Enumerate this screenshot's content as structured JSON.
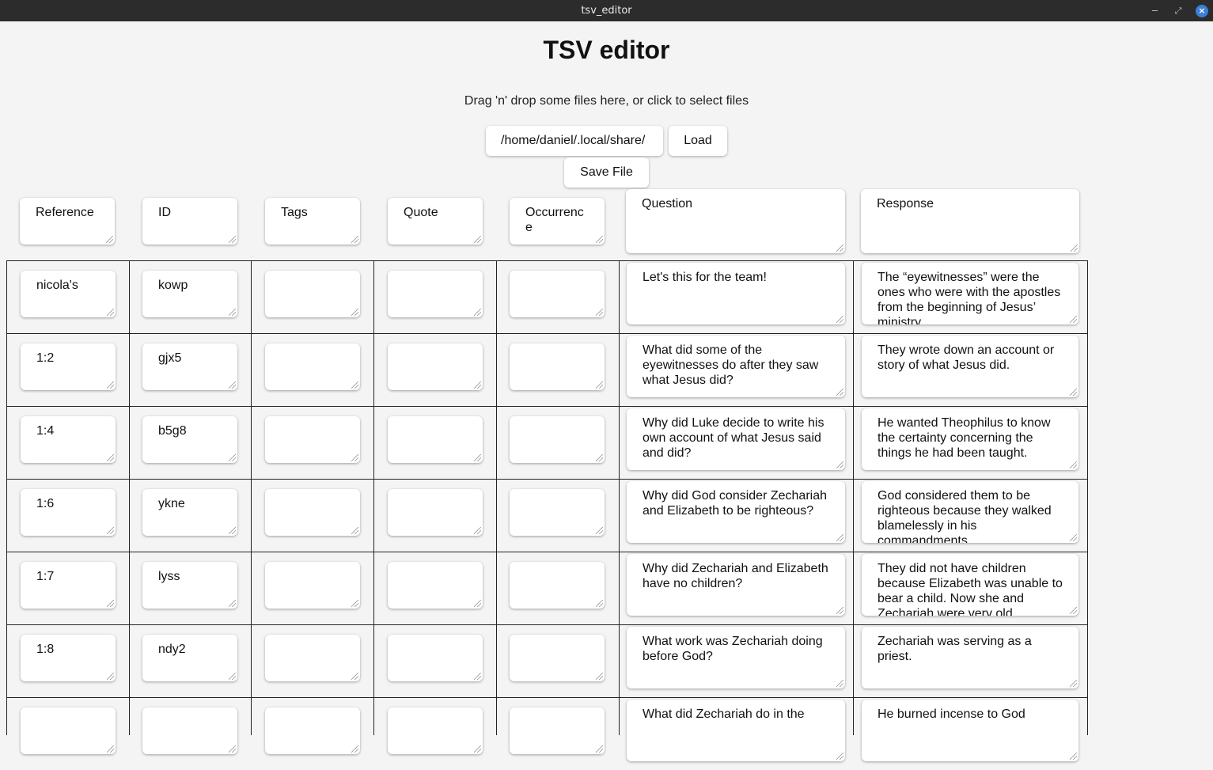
{
  "window": {
    "title": "tsv_editor"
  },
  "page": {
    "heading": "TSV editor",
    "dropzone_text": "Drag 'n' drop some files here, or click to select files",
    "path_value": "/home/daniel/.local/share/",
    "load_label": "Load",
    "save_label": "Save File"
  },
  "columns": [
    "Reference",
    "ID",
    "Tags",
    "Quote",
    "Occurrence",
    "Question",
    "Response"
  ],
  "rows": [
    {
      "reference": "nicola's",
      "id": "kowp",
      "tags": "",
      "quote": "",
      "occurrence": "",
      "question": "Let's this for the team!",
      "response": "The “eyewitnesses” were the ones who were with the apostles from the beginning of Jesus’ ministry."
    },
    {
      "reference": "1:2",
      "id": "gjx5",
      "tags": "",
      "quote": "",
      "occurrence": "",
      "question": "What did some of the eyewitnesses do after they saw what Jesus did?",
      "response": "They wrote down an account or story of what Jesus did."
    },
    {
      "reference": "1:4",
      "id": "b5g8",
      "tags": "",
      "quote": "",
      "occurrence": "",
      "question": "Why did Luke decide to write his own account of what Jesus said and did?",
      "response": "He wanted Theophilus to know the certainty concerning the things he had been taught."
    },
    {
      "reference": "1:6",
      "id": "ykne",
      "tags": "",
      "quote": "",
      "occurrence": "",
      "question": "Why did God consider Zechariah and Elizabeth to be righteous?",
      "response": "God considered them to be righteous because they walked blamelessly in his commandments."
    },
    {
      "reference": "1:7",
      "id": "lyss",
      "tags": "",
      "quote": "",
      "occurrence": "",
      "question": "Why did Zechariah and Elizabeth have no children?",
      "response": "They did not have children because Elizabeth was unable to bear a child. Now she and Zechariah were very old."
    },
    {
      "reference": "1:8",
      "id": "ndy2",
      "tags": "",
      "quote": "",
      "occurrence": "",
      "question": "What work was Zechariah doing before God?",
      "response": "Zechariah was serving as a priest."
    },
    {
      "reference": "",
      "id": "",
      "tags": "",
      "quote": "",
      "occurrence": "",
      "question": "What did Zechariah do in the",
      "response": "He burned incense to God"
    }
  ]
}
